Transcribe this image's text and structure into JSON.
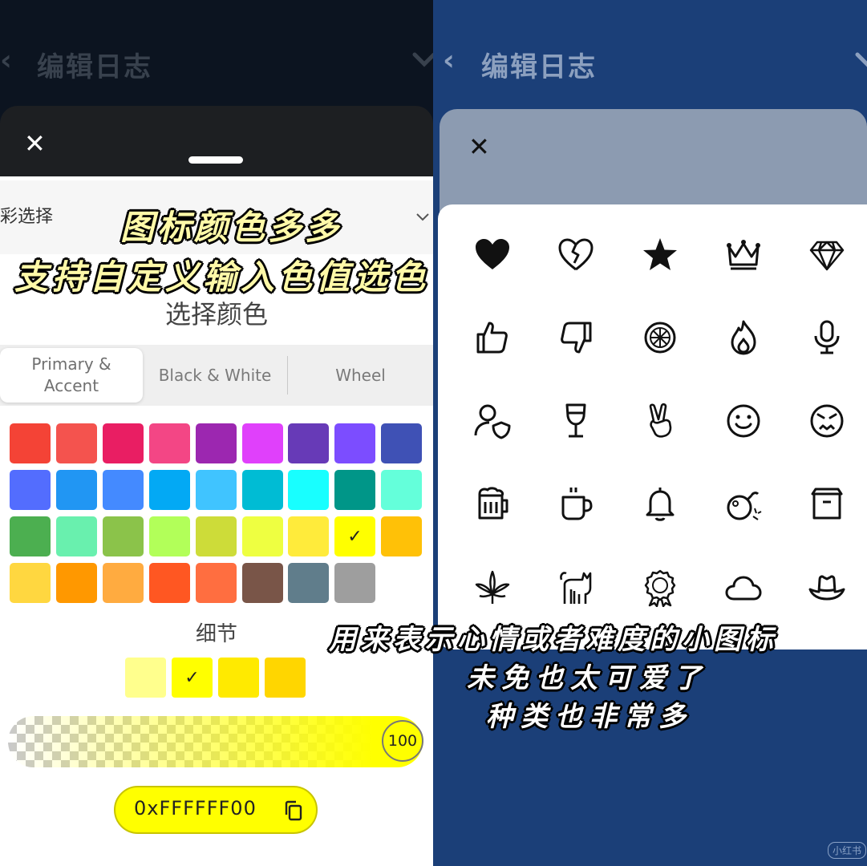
{
  "left": {
    "header_title": "编辑日志",
    "close_glyph": "✕",
    "row_label": "彩选择",
    "dialog_title": "选择颜色",
    "tabs": [
      {
        "label": "Primary &\nAccent",
        "active": true
      },
      {
        "label": "Black & White",
        "active": false
      },
      {
        "label": "Wheel",
        "active": false
      }
    ],
    "swatches": [
      [
        "#f44336",
        "#f4534e",
        "#e91e63",
        "#f34685",
        "#9c27b0",
        "#e040fb",
        "#673ab7",
        "#7c4dff",
        "#3f51b5"
      ],
      [
        "#536dfe",
        "#2196f3",
        "#448aff",
        "#03a9f4",
        "#40c4ff",
        "#00bcd4",
        "#18ffff",
        "#009688",
        "#64ffda"
      ],
      [
        "#4caf50",
        "#69f0ae",
        "#8bc34a",
        "#b2ff59",
        "#cddc39",
        "#eeff41",
        "#ffeb3b",
        "#ffff00",
        "#ffc107"
      ],
      [
        "#ffd740",
        "#ff9800",
        "#ffab40",
        "#ff5722",
        "#ff6e40",
        "#795548",
        "#607d8b",
        "#9e9e9e"
      ]
    ],
    "selected_swatch": "#ffff00",
    "detail_label": "细节",
    "shades": [
      "#ffff8d",
      "#ffff00",
      "#ffea00",
      "#ffd600"
    ],
    "selected_shade": "#ffff00",
    "opacity_value": "100",
    "hex_value": "0xFFFFFF00",
    "check_glyph": "✓"
  },
  "right": {
    "header_title": "编辑日志",
    "close_glyph": "✕",
    "icons": [
      [
        "heart-filled-icon",
        "heart-broken-icon",
        "star-filled-icon",
        "crown-icon",
        "diamond-icon"
      ],
      [
        "thumbs-up-icon",
        "thumbs-down-icon",
        "lemon-icon",
        "fire-icon",
        "microphone-icon"
      ],
      [
        "user-shield-icon",
        "wine-glass-icon",
        "peace-hand-icon",
        "smiley-icon",
        "angry-face-icon"
      ],
      [
        "beer-mug-icon",
        "coffee-cup-icon",
        "bell-icon",
        "bomb-icon",
        "box-icon"
      ],
      [
        "leaf-icon",
        "cat-icon",
        "award-ribbon-icon",
        "cloud-icon",
        "cowboy-hat-icon"
      ]
    ]
  },
  "captions": {
    "top_line1": "图标颜色多多",
    "top_line2": "支持自定义输入色值选色",
    "bottom_line1": "用来表示心情或者难度的小图标",
    "bottom_line2": "未免也太可爱了",
    "bottom_line3": "种类也非常多"
  },
  "watermark": "小红书"
}
